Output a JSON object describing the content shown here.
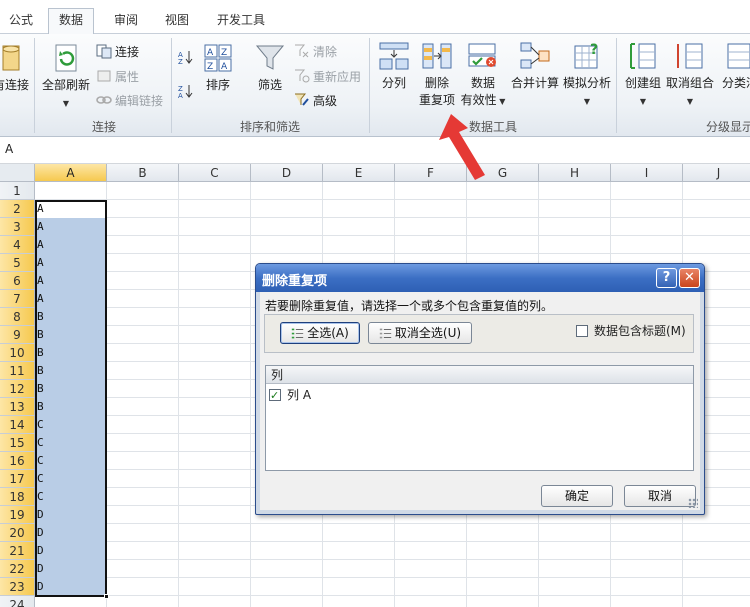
{
  "tabs": [
    {
      "label": "公式",
      "active": false
    },
    {
      "label": "数据",
      "active": true
    },
    {
      "label": "审阅",
      "active": false
    },
    {
      "label": "视图",
      "active": false
    },
    {
      "label": "开发工具",
      "active": false
    }
  ],
  "ribbon": {
    "connections": {
      "partial_label": "有连接",
      "refresh_label": "全部刷新",
      "connections_label": "连接",
      "properties_label": "属性",
      "edit_links_label": "编辑链接",
      "group_label": "连接"
    },
    "sort_filter": {
      "sort_label": "排序",
      "filter_label": "筛选",
      "clear_label": "清除",
      "reapply_label": "重新应用",
      "advanced_label": "高级",
      "group_label": "排序和筛选"
    },
    "data_tools": {
      "split_label": "分列",
      "remove_dup_label_1": "删除",
      "remove_dup_label_2": "重复项",
      "validation_label_1": "数据",
      "validation_label_2": "有效性",
      "consolidate_label": "合并计算",
      "whatif_label": "模拟分析",
      "group_label": "数据工具"
    },
    "outline": {
      "group_label_btn": "创建组",
      "ungroup_label": "取消组合",
      "subtotal_label": "分类汇",
      "group_label": "分级显示"
    }
  },
  "formula_bar": {
    "value": "A"
  },
  "sheet": {
    "columns": [
      "A",
      "B",
      "C",
      "D",
      "E",
      "F",
      "G",
      "H",
      "I",
      "J"
    ],
    "selected_column": "A",
    "rows": [
      {
        "num": "1",
        "a": ""
      },
      {
        "num": "2",
        "a": "A"
      },
      {
        "num": "3",
        "a": "A"
      },
      {
        "num": "4",
        "a": "A"
      },
      {
        "num": "5",
        "a": "A"
      },
      {
        "num": "6",
        "a": "A"
      },
      {
        "num": "7",
        "a": "A"
      },
      {
        "num": "8",
        "a": "B"
      },
      {
        "num": "9",
        "a": "B"
      },
      {
        "num": "10",
        "a": "B"
      },
      {
        "num": "11",
        "a": "B"
      },
      {
        "num": "12",
        "a": "B"
      },
      {
        "num": "13",
        "a": "B"
      },
      {
        "num": "14",
        "a": "C"
      },
      {
        "num": "15",
        "a": "C"
      },
      {
        "num": "16",
        "a": "C"
      },
      {
        "num": "17",
        "a": "C"
      },
      {
        "num": "18",
        "a": "C"
      },
      {
        "num": "19",
        "a": "D"
      },
      {
        "num": "20",
        "a": "D"
      },
      {
        "num": "21",
        "a": "D"
      },
      {
        "num": "22",
        "a": "D"
      },
      {
        "num": "23",
        "a": "D"
      },
      {
        "num": "24",
        "a": ""
      }
    ]
  },
  "dialog": {
    "title": "删除重复项",
    "instruction": "若要删除重复值，请选择一个或多个包含重复值的列。",
    "select_all_label": "全选(A)",
    "unselect_all_label": "取消全选(U)",
    "has_headers_label": "数据包含标题(M)",
    "has_headers_checked": false,
    "list_header": "列",
    "list_items": [
      {
        "label": "列 A",
        "checked": true
      }
    ],
    "ok_label": "确定",
    "cancel_label": "取消",
    "help_glyph": "?",
    "close_glyph": "✕"
  },
  "colors": {
    "selection_fill": "#b9cde6",
    "selected_header": "#f6c94f",
    "dialog_title": "#3c6fc4",
    "arrow": "#e53935"
  },
  "icons": [
    "refresh-icon",
    "connections-icon",
    "properties-icon",
    "edit-links-icon",
    "sort-az-icon",
    "sort-za-icon",
    "sort-icon",
    "filter-icon",
    "clear-icon",
    "reapply-icon",
    "advanced-icon",
    "text-to-columns-icon",
    "remove-duplicates-icon",
    "data-validation-icon",
    "consolidate-icon",
    "what-if-icon",
    "group-icon",
    "ungroup-icon",
    "subtotal-icon",
    "select-all-icon",
    "unselect-all-icon",
    "annotation-arrow-icon"
  ]
}
